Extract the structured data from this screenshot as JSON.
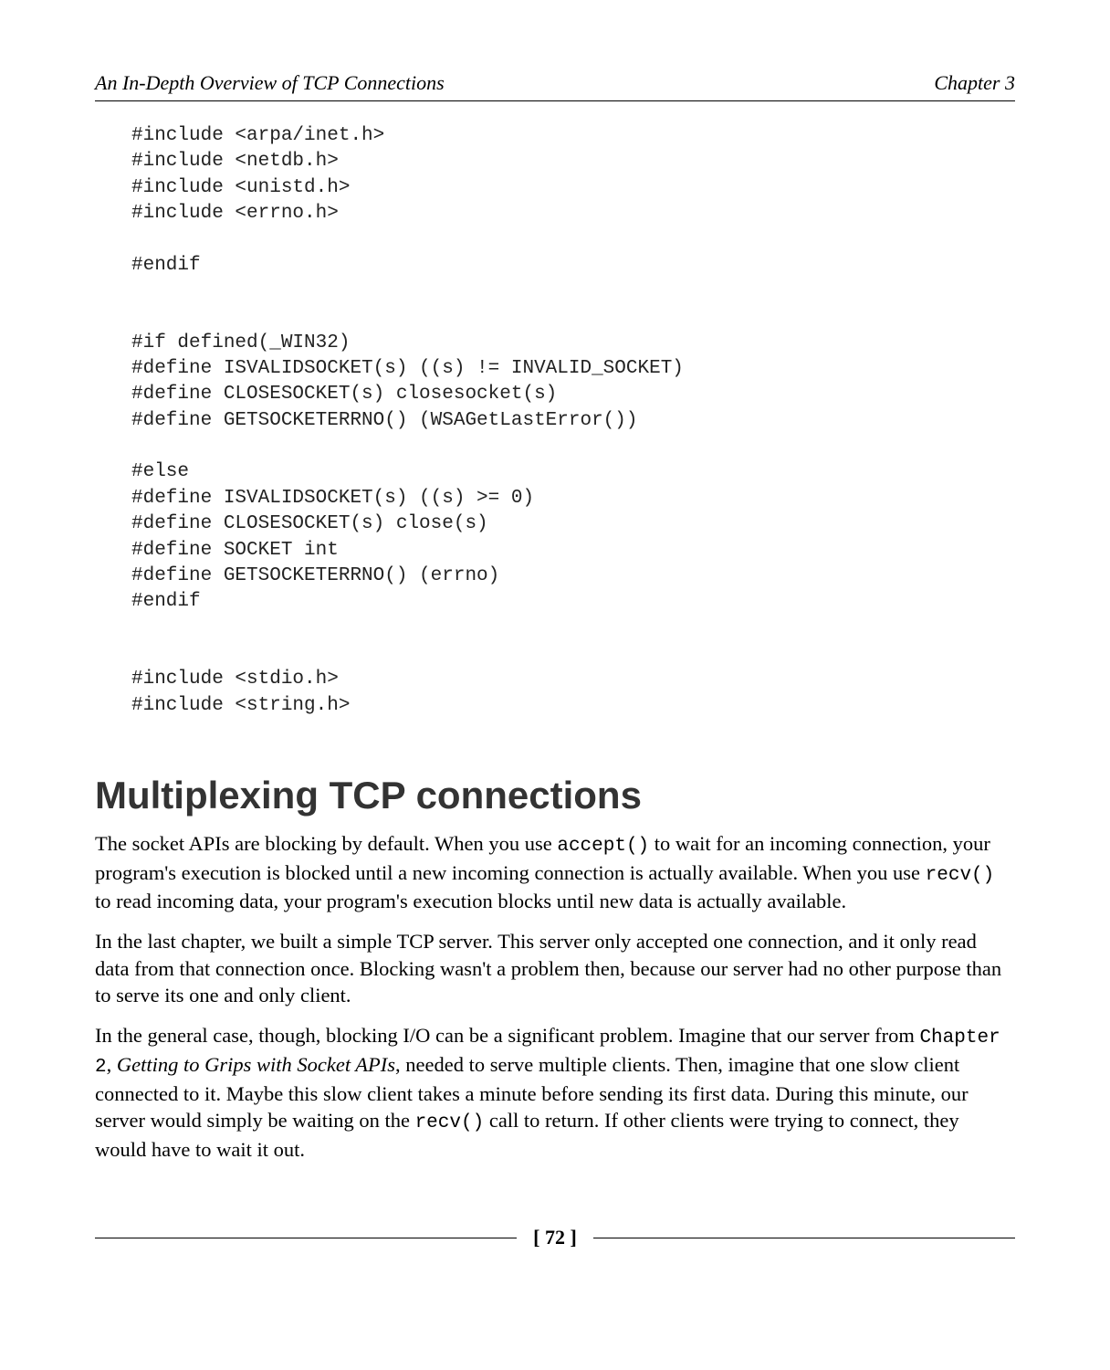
{
  "header": {
    "title_left": "An In-Depth Overview of TCP Connections",
    "title_right": "Chapter 3"
  },
  "code": {
    "block": "#include <arpa/inet.h>\n#include <netdb.h>\n#include <unistd.h>\n#include <errno.h>\n\n#endif\n\n\n#if defined(_WIN32)\n#define ISVALIDSOCKET(s) ((s) != INVALID_SOCKET)\n#define CLOSESOCKET(s) closesocket(s)\n#define GETSOCKETERRNO() (WSAGetLastError())\n\n#else\n#define ISVALIDSOCKET(s) ((s) >= 0)\n#define CLOSESOCKET(s) close(s)\n#define SOCKET int\n#define GETSOCKETERRNO() (errno)\n#endif\n\n\n#include <stdio.h>\n#include <string.h>"
  },
  "section": {
    "heading": "Multiplexing TCP connections",
    "p1_a": "The socket APIs are blocking by default. When you use ",
    "p1_code1": "accept()",
    "p1_b": " to wait for an incoming connection, your program's execution is blocked until a new incoming connection is actually available. When you use ",
    "p1_code2": "recv()",
    "p1_c": " to read incoming data, your program's execution blocks until new data is actually available.",
    "p2": "In the last chapter, we built a simple TCP server. This server only accepted one connection, and it only read data from that connection once. Blocking wasn't a problem then, because our server had no other purpose than to serve its one and only client.",
    "p3_a": "In the general case, though, blocking I/O can be a significant problem. Imagine that our server from ",
    "p3_code1": "Chapter 2",
    "p3_b": ", ",
    "p3_ital": "Getting to Grips with Socket APIs",
    "p3_c": ", needed to serve multiple clients. Then, imagine that one slow client connected to it. Maybe this slow client takes a minute before sending its first data. During this minute, our server would simply be waiting on the ",
    "p3_code2": "recv()",
    "p3_d": " call to return. If other clients were trying to connect, they would have to wait it out."
  },
  "footer": {
    "page_number": "[ 72 ]"
  }
}
